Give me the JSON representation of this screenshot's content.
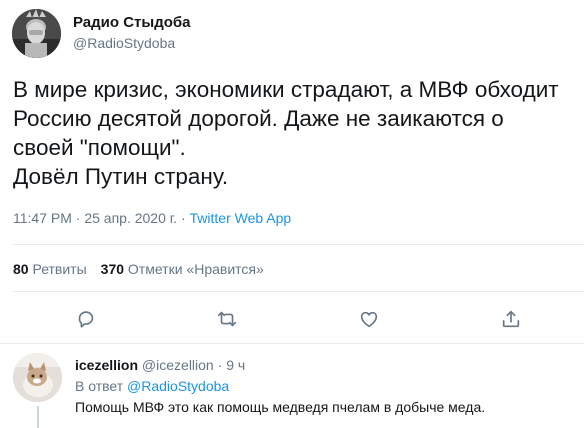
{
  "tweet": {
    "author_name": "Радио Стыдоба",
    "author_handle": "@RadioStydoba",
    "text_lines": [
      "В мире кризис, экономики страдают, а МВФ обходит",
      "Россию десятой дорогой. Даже не заикаются о",
      "своей \"помощи\".",
      "Довёл Путин страну."
    ],
    "time": "11:47 PM",
    "date": "25 апр. 2020 г.",
    "separator": "·",
    "source": "Twitter Web App",
    "retweets_count": "80",
    "retweets_label": "Ретвиты",
    "likes_count": "370",
    "likes_label": "Отметки «Нравится»"
  },
  "actions": {
    "reply_icon": "reply-icon",
    "retweet_icon": "retweet-icon",
    "like_icon": "heart-icon",
    "share_icon": "share-icon"
  },
  "reply": {
    "author_name": "icezellion",
    "author_handle": "@icezellion",
    "separator": "·",
    "time": "9 ч",
    "in_reply_prefix": "В ответ",
    "in_reply_to": "@RadioStydoba",
    "text": "Помощь МВФ это как помощь медведя пчелам в добыче меда."
  },
  "colors": {
    "text": "#14171a",
    "secondary": "#657786",
    "link": "#1b95e0",
    "divider": "#e6ecf0"
  }
}
